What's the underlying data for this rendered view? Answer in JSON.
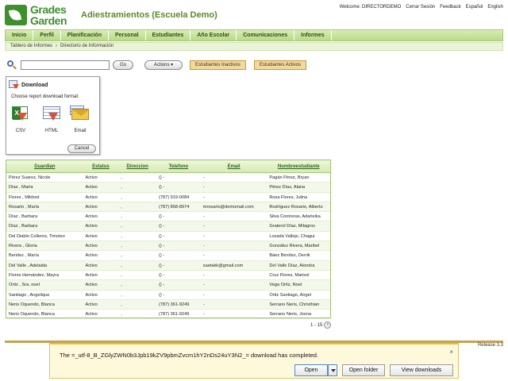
{
  "header": {
    "logo_line1": "Grades",
    "logo_line2": "Garden",
    "app_title": "Adiestramientos (Escuela Demo)",
    "top_links": [
      "Welcome: DIRECTORDEMO",
      "Cerrar Sesión",
      "Feedback",
      "Español",
      "English"
    ]
  },
  "nav": [
    "Inicio",
    "Perfil",
    "Planificación",
    "Personal",
    "Estudiantes",
    "Año Escolar",
    "Comunicaciones",
    "Informes"
  ],
  "breadcrumb": [
    "Tablero de Informes",
    "›",
    "Directorio de Información"
  ],
  "toolbar": {
    "search_placeholder": "",
    "go_label": "Go",
    "actions_label": "Actions ▾",
    "inactive_label": "Estudiantes Inactivos",
    "active_label": "Estudiantes Activos"
  },
  "download": {
    "title": "Download",
    "prompt": "Choose report download format:",
    "formats": [
      "CSV",
      "HTML",
      "Email"
    ],
    "cancel_label": "Cancel"
  },
  "table": {
    "headers": [
      "Guardian",
      "Estatus",
      "Direccion",
      "Telefono",
      "Email",
      "Nombreestudiante"
    ],
    "rows": [
      [
        "Pérez Suarez, Nicole",
        "Activo",
        ",",
        "() -",
        "-",
        "Pagán Pérez, Bryan"
      ],
      [
        "Díaz , María",
        "Activo",
        ",",
        "() -",
        "-",
        "Pérez Díaz, Alana"
      ],
      [
        "Flores , Mildred",
        "Activo",
        ",",
        "(787) 919-0084",
        "-",
        "Rosa Flores, Julina"
      ],
      [
        "Rosario , María",
        "Activo",
        ",",
        "(787) 858-8974",
        "mrosario@demomail.com",
        "Rodríguez Rosario, Alberto"
      ],
      [
        "Díaz , Barbara",
        "Activo",
        ",",
        "() -",
        "-",
        "Silva Contreras, Adarleika"
      ],
      [
        "Díaz , Barbara",
        "Activo",
        ",",
        "() -",
        "-",
        "Graterol Díaz, Milagros"
      ],
      [
        "Del Diablo Colleres, Timoteo",
        "Activo",
        ",",
        "() -",
        "-",
        "Lozada Vallejo, Chagui"
      ],
      [
        "Rivera , Gloria",
        "Activo",
        ",",
        "() -",
        "-",
        "González Rivera, Maribel"
      ],
      [
        "Benítez , María",
        "Activo",
        ",",
        "() -",
        "-",
        "Báez Benítez, Derrik"
      ],
      [
        "Del Valle , Adelaida",
        "Activo",
        ",",
        "() -",
        "saetakk@gmail.com",
        "Del Valle Díaz, Alondra"
      ],
      [
        "Flores Hernández, Mayra",
        "Activo",
        ",",
        "() -",
        "-",
        "Cruz Flores, Marisol"
      ],
      [
        "Ortiz , Sra. noel",
        "Activo",
        ",",
        "() -",
        "-",
        "Vega Ortiz, Noel"
      ],
      [
        "Santiago , Angelique",
        "Activo",
        ",",
        "() -",
        "-",
        "Ortiz Santiago, Angel"
      ],
      [
        "Neris Oquendo, Blanca",
        "Activo",
        ",",
        "(787) 361-9249",
        "-",
        "Serrano Neris, Christhian"
      ],
      [
        "Neris Oquendo, Blanca",
        "Activo",
        ",",
        "(787) 361-9249",
        "-",
        "Serrano Neris, Josna"
      ]
    ]
  },
  "pager": {
    "range": "1 - 15",
    "next": "›"
  },
  "release": "Release 3.3",
  "download_bar": {
    "message": "The =_utf-8_B_ZGlyZWN0b3Jpb19kZV9pbmZvcm1hY2nDs24uY3N2_= download has completed.",
    "open_label": "Open",
    "open_folder_label": "Open folder",
    "view_downloads_label": "View downloads",
    "close": "×"
  }
}
